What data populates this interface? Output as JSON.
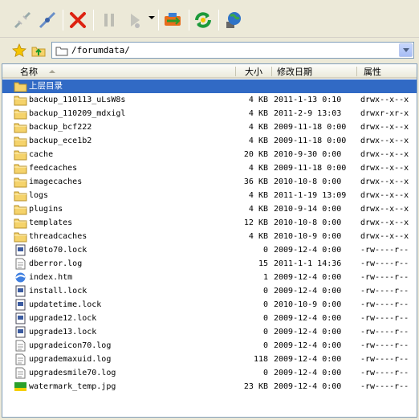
{
  "toolbar": {
    "buttons": [
      {
        "name": "disconnect-icon",
        "label": ""
      },
      {
        "name": "connect-icon",
        "label": ""
      },
      {
        "name": "delete-icon",
        "label": ""
      },
      {
        "name": "pause-icon",
        "label": ""
      },
      {
        "name": "play-icon",
        "label": ""
      },
      {
        "name": "transfer-icon",
        "label": ""
      },
      {
        "name": "refresh-icon",
        "label": ""
      },
      {
        "name": "globe-icon",
        "label": ""
      }
    ]
  },
  "address": {
    "path": "/forumdata/"
  },
  "columns": {
    "name": "名称",
    "size": "大小",
    "modified": "修改日期",
    "attributes": "属性"
  },
  "colors": {
    "selection": "#316ac5",
    "folder": "#f5d36b"
  },
  "rows": [
    {
      "type": "folder-up",
      "name": "上层目录",
      "size": "",
      "date": "",
      "perm": "",
      "selected": true
    },
    {
      "type": "folder",
      "name": "backup_110113_uLsW8s",
      "size": "4 KB",
      "date": "2011-1-13 0:10",
      "perm": "drwx--x--x"
    },
    {
      "type": "folder",
      "name": "backup_110209_mdxigl",
      "size": "4 KB",
      "date": "2011-2-9 13:03",
      "perm": "drwxr-xr-x"
    },
    {
      "type": "folder",
      "name": "backup_bcf222",
      "size": "4 KB",
      "date": "2009-11-18 0:00",
      "perm": "drwx--x--x"
    },
    {
      "type": "folder",
      "name": "backup_ece1b2",
      "size": "4 KB",
      "date": "2009-11-18 0:00",
      "perm": "drwx--x--x"
    },
    {
      "type": "folder",
      "name": "cache",
      "size": "20 KB",
      "date": "2010-9-30 0:00",
      "perm": "drwx--x--x"
    },
    {
      "type": "folder",
      "name": "feedcaches",
      "size": "4 KB",
      "date": "2009-11-18 0:00",
      "perm": "drwx--x--x"
    },
    {
      "type": "folder",
      "name": "imagecaches",
      "size": "36 KB",
      "date": "2010-10-8 0:00",
      "perm": "drwx--x--x"
    },
    {
      "type": "folder",
      "name": "logs",
      "size": "4 KB",
      "date": "2011-1-19 13:09",
      "perm": "drwx--x--x"
    },
    {
      "type": "folder",
      "name": "plugins",
      "size": "4 KB",
      "date": "2010-9-14 0:00",
      "perm": "drwx--x--x"
    },
    {
      "type": "folder",
      "name": "templates",
      "size": "12 KB",
      "date": "2010-10-8 0:00",
      "perm": "drwx--x--x"
    },
    {
      "type": "folder",
      "name": "threadcaches",
      "size": "4 KB",
      "date": "2010-10-9 0:00",
      "perm": "drwx--x--x"
    },
    {
      "type": "lock",
      "name": "d60to70.lock",
      "size": "0",
      "date": "2009-12-4 0:00",
      "perm": "-rw----r--"
    },
    {
      "type": "log",
      "name": "dberror.log",
      "size": "15",
      "date": "2011-1-1 14:36",
      "perm": "-rw----r--"
    },
    {
      "type": "htm",
      "name": "index.htm",
      "size": "1",
      "date": "2009-12-4 0:00",
      "perm": "-rw----r--"
    },
    {
      "type": "lock",
      "name": "install.lock",
      "size": "0",
      "date": "2009-12-4 0:00",
      "perm": "-rw----r--"
    },
    {
      "type": "lock",
      "name": "updatetime.lock",
      "size": "0",
      "date": "2010-10-9 0:00",
      "perm": "-rw----r--"
    },
    {
      "type": "lock",
      "name": "upgrade12.lock",
      "size": "0",
      "date": "2009-12-4 0:00",
      "perm": "-rw----r--"
    },
    {
      "type": "lock",
      "name": "upgrade13.lock",
      "size": "0",
      "date": "2009-12-4 0:00",
      "perm": "-rw----r--"
    },
    {
      "type": "log",
      "name": "upgradeicon70.log",
      "size": "0",
      "date": "2009-12-4 0:00",
      "perm": "-rw----r--"
    },
    {
      "type": "log",
      "name": "upgrademaxuid.log",
      "size": "118",
      "date": "2009-12-4 0:00",
      "perm": "-rw----r--"
    },
    {
      "type": "log",
      "name": "upgradesmile70.log",
      "size": "0",
      "date": "2009-12-4 0:00",
      "perm": "-rw----r--"
    },
    {
      "type": "jpg",
      "name": "watermark_temp.jpg",
      "size": "23 KB",
      "date": "2009-12-4 0:00",
      "perm": "-rw----r--"
    }
  ]
}
